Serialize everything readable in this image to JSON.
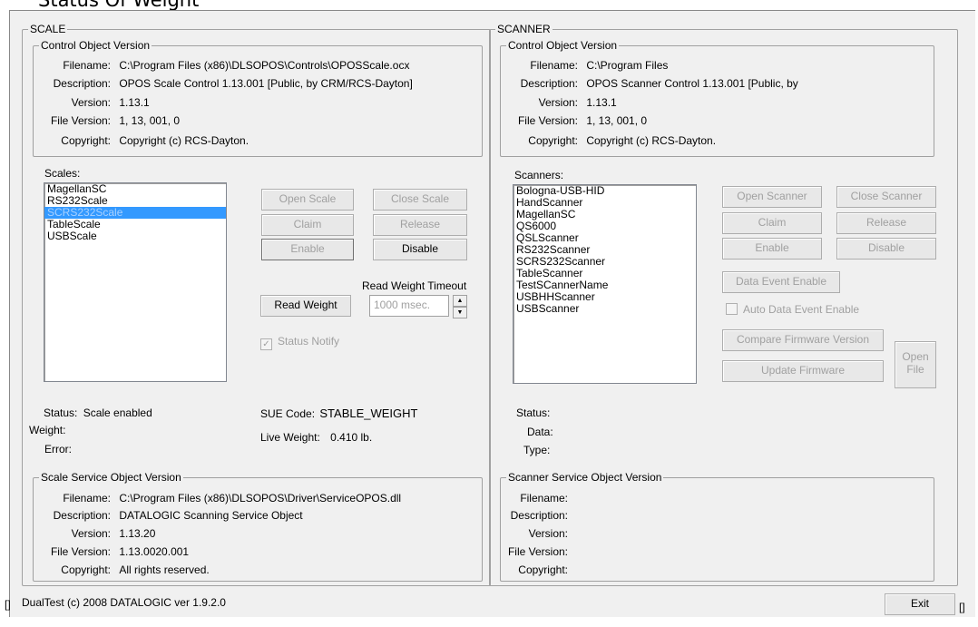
{
  "top_title": "Status Of Weight",
  "scale": {
    "group_label": "SCALE",
    "control": {
      "group_label": "Control Object Version",
      "filename_label": "Filename:",
      "filename": "C:\\Program Files (x86)\\DLSOPOS\\Controls\\OPOSScale.ocx",
      "description_label": "Description:",
      "description": "OPOS Scale Control 1.13.001 [Public, by CRM/RCS-Dayton]",
      "version_label": "Version:",
      "version": "1.13.1",
      "file_version_label": "File Version:",
      "file_version": "1, 13, 001, 0",
      "copyright_label": "Copyright:",
      "copyright": "Copyright (c) RCS-Dayton."
    },
    "list_label": "Scales:",
    "devices": [
      "MagellanSC",
      "RS232Scale",
      "SCRS232Scale",
      "TableScale",
      "USBScale"
    ],
    "selected_device": "SCRS232Scale",
    "open_label": "Open Scale",
    "close_label": "Close Scale",
    "claim_label": "Claim",
    "release_label": "Release",
    "enable_label": "Enable",
    "disable_label": "Disable",
    "timeout_label": "Read Weight Timeout",
    "read_weight_label": "Read Weight",
    "timeout_value": "1000 msec.",
    "status_notify_label": "Status Notify",
    "status_notify_checked": true,
    "status_label": "Status:",
    "status_value": "Scale enabled",
    "weight_label": "Weight:",
    "weight_value": "",
    "error_label": "Error:",
    "error_value": "",
    "sue_label": "SUE Code:",
    "sue_value": "STABLE_WEIGHT",
    "live_label": "Live Weight:",
    "live_value": "0.410 lb.",
    "service": {
      "group_label": "Scale Service Object Version",
      "filename_label": "Filename:",
      "filename": "C:\\Program Files (x86)\\DLSOPOS\\Driver\\ServiceOPOS.dll",
      "description_label": "Description:",
      "description": "DATALOGIC Scanning Service Object",
      "version_label": "Version:",
      "version": "1.13.20",
      "file_version_label": "File Version:",
      "file_version": "1.13.0020.001",
      "copyright_label": "Copyright:",
      "copyright": "All rights reserved."
    }
  },
  "scanner": {
    "group_label": "SCANNER",
    "control": {
      "group_label": "Control Object Version",
      "filename_label": "Filename:",
      "filename": "C:\\Program Files",
      "description_label": "Description:",
      "description": "OPOS Scanner Control 1.13.001 [Public, by",
      "version_label": "Version:",
      "version": "1.13.1",
      "file_version_label": "File Version:",
      "file_version": "1, 13, 001, 0",
      "copyright_label": "Copyright:",
      "copyright": "Copyright (c) RCS-Dayton."
    },
    "list_label": "Scanners:",
    "devices": [
      "Bologna-USB-HID",
      "HandScanner",
      "MagellanSC",
      "QS6000",
      "QSLScanner",
      "RS232Scanner",
      "SCRS232Scanner",
      "TableScanner",
      "TestSCannerName",
      "USBHHScanner",
      "USBScanner"
    ],
    "open_label": "Open Scanner",
    "close_label": "Close Scanner",
    "claim_label": "Claim",
    "release_label": "Release",
    "enable_label": "Enable",
    "disable_label": "Disable",
    "data_event_label": "Data Event Enable",
    "auto_data_event_label": "Auto Data Event Enable",
    "auto_data_event_checked": false,
    "compare_fw_label": "Compare Firmware Version",
    "update_fw_label": "Update Firmware",
    "open_file_line1": "Open",
    "open_file_line2": "File",
    "status_label": "Status:",
    "data_label": "Data:",
    "type_label": "Type:",
    "service": {
      "group_label": "Scanner Service Object Version",
      "filename_label": "Filename:",
      "description_label": "Description:",
      "version_label": "Version:",
      "file_version_label": "File Version:",
      "copyright_label": "Copyright:"
    }
  },
  "footer": {
    "left_bracket": "[]",
    "about": "DualTest (c) 2008 DATALOGIC ver 1.9.2.0",
    "exit_label": "Exit",
    "right_bracket": "[]"
  }
}
